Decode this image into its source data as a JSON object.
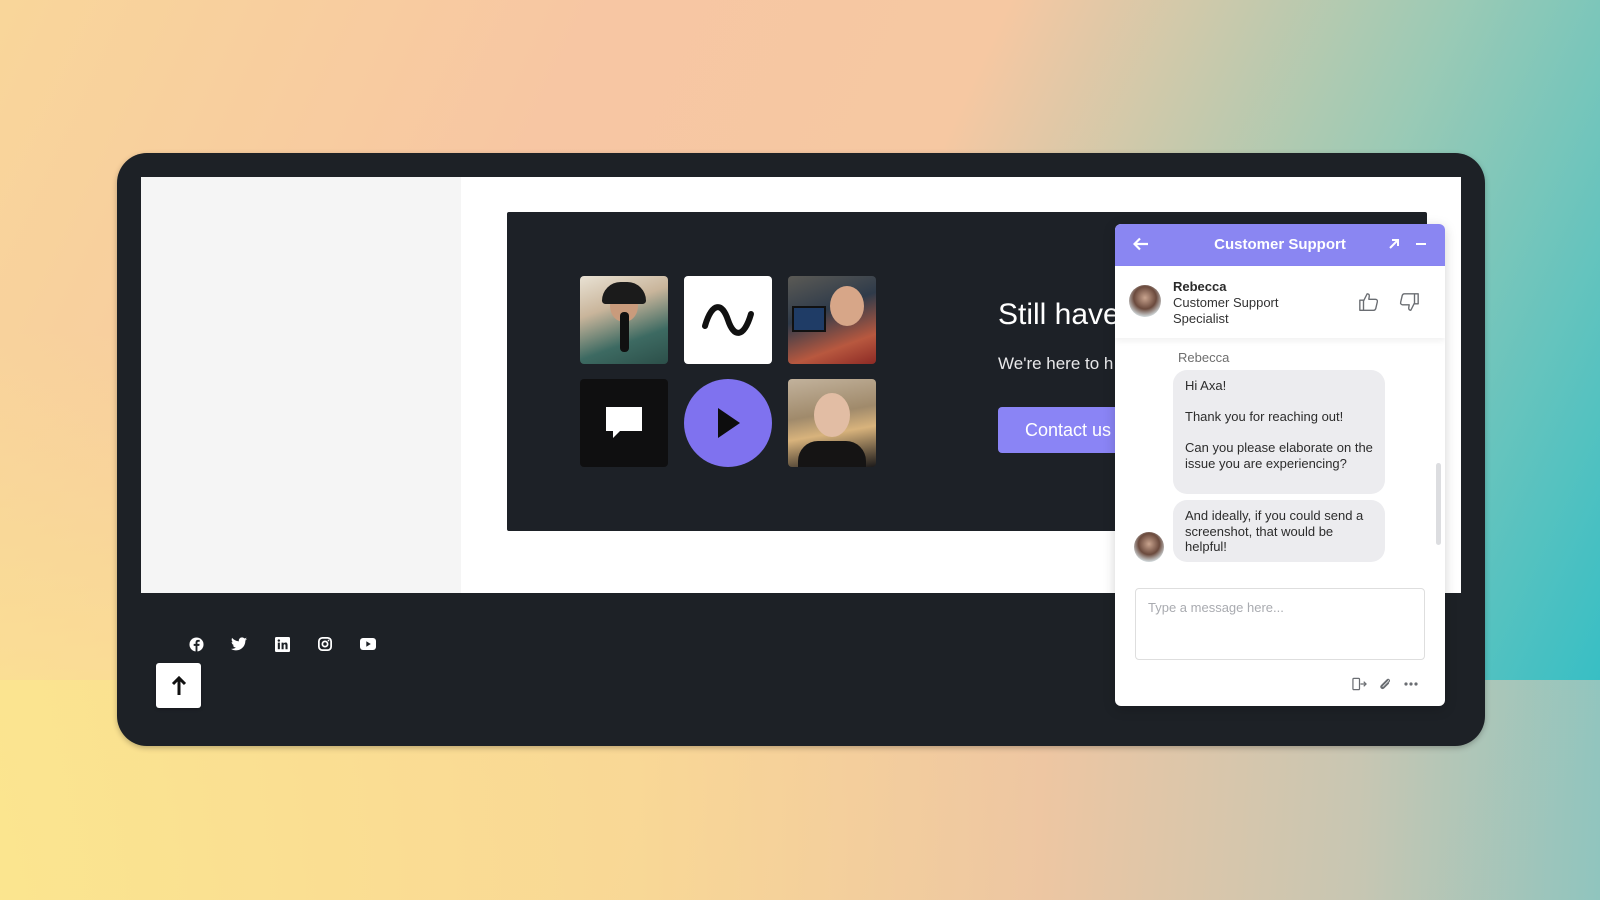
{
  "banner": {
    "title": "Still have",
    "subtitle": "We're here to h",
    "contact_button": "Contact us",
    "tiles": [
      {
        "kind": "photo",
        "label": "podcaster-woman-photo"
      },
      {
        "kind": "icon",
        "icon": "wave-icon"
      },
      {
        "kind": "photo",
        "label": "podcaster-man-photo"
      },
      {
        "kind": "icon",
        "icon": "chat-bubble-icon"
      },
      {
        "kind": "icon",
        "icon": "play-icon"
      },
      {
        "kind": "photo",
        "label": "woman-headset-photo"
      }
    ],
    "accent_color": "#8a84f5"
  },
  "footer": {
    "social_icons": [
      "facebook-icon",
      "twitter-icon",
      "linkedin-icon",
      "instagram-icon",
      "youtube-icon"
    ],
    "back_to_top_icon": "arrow-up-icon"
  },
  "chat": {
    "header": {
      "title": "Customer Support",
      "back_icon": "arrow-left-icon",
      "expand_icon": "arrow-up-right-icon",
      "minimize_icon": "minus-icon",
      "color": "#8a86f2"
    },
    "agent": {
      "name": "Rebecca",
      "role": "Customer Support Specialist"
    },
    "messages": [
      {
        "sender": "Rebecca",
        "lines": [
          "Hi Axa!",
          "",
          "Thank you for reaching out!",
          "",
          "Can you please elaborate on the issue you are experiencing?"
        ]
      },
      {
        "sender": "Rebecca",
        "lines": [
          "And ideally, if you could send a screenshot, that would be helpful!"
        ]
      }
    ],
    "input": {
      "placeholder": "Type a message here...",
      "value": ""
    },
    "tools": [
      "exit-icon",
      "paperclip-icon",
      "more-icon"
    ]
  }
}
